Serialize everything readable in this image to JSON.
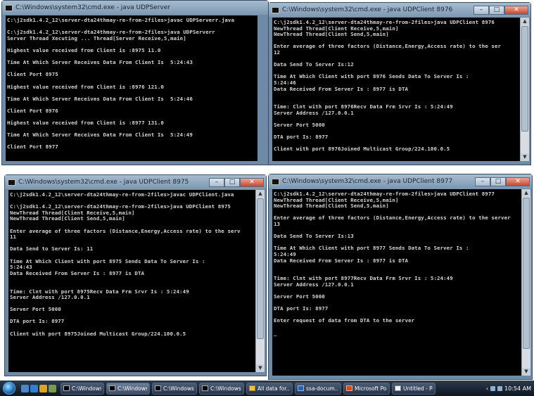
{
  "windows": {
    "server": {
      "title": "C:\\Windows\\system32\\cmd.exe - java  UDPServer",
      "lines": [
        "C:\\j2sdk1.4.2_12\\server-dta24thmay-re-from-2files>javac UDPServerr.java",
        "",
        "C:\\j2sdk1.4.2_12\\server-dta24thmay-re-from-2files>java UDPServerr",
        "Server Thread Xecuting ... Thread[Server Receive,5,main]",
        "",
        "Highest value received from Client is :8975 11.0",
        "",
        "Time At Which Server Receives Data From Client Is  5:24:43",
        "",
        "Client Port 8975",
        "",
        "Highest value received from Client is :8976 121.0",
        "",
        "Time At Which Server Receives Data From Client Is  5:24:46",
        "",
        "Client Port 8976",
        "",
        "Highest value received from Client is :8977 131.0",
        "",
        "Time At Which Server Receives Data From Client Is  5:24:49",
        "",
        "Client Port 8977"
      ]
    },
    "client8976": {
      "title": "C:\\Windows\\system32\\cmd.exe - java  UDPClient 8976",
      "lines": [
        "C:\\j2sdk1.4.2_12\\server-dta24thmay-re-from-2files>java UDPClient 8976",
        "NewThread Thread[Client Receive,5,main]",
        "NewThread Thread[Client Send,5,main]",
        "",
        "Enter average of three factors (Distance,Energy,Access rate) to the ser",
        "12",
        "",
        "Data Send To Server Is:12",
        "",
        "Time At Which Client with port 8976 Sends Data To Server Is :",
        "5:24:46",
        "Data Received From Server Is : 8977 is DTA",
        "",
        "",
        "Time: Clnt with port 8976Recv Data Frm Srvr Is : 5:24:49",
        "Server Address /127.0.0.1",
        "",
        "Server Port 5000",
        "",
        "DTA port Is: 8977",
        "",
        "Client with port 8976Joined Multicast Group/224.100.0.5"
      ]
    },
    "client8975": {
      "title": "C:\\Windows\\system32\\cmd.exe - java  UDPClient 8975",
      "lines": [
        "C:\\j2sdk1.4.2_12\\server-dta24thmay-re-from-2files>javac UDPClient.java",
        "",
        "C:\\j2sdk1.4.2_12\\server-dta24thmay-re-from-2files>java UDPClient 8975",
        "NewThread Thread[Client Receive,5,main]",
        "NewThread Thread[Client Send,5,main]",
        "",
        "Enter average of three factors (Distance,Energy,Access rate) to the serv",
        "11",
        "",
        "Data Send to Server Is: 11",
        "",
        "Time At Which Client with port 8975 Sends Data To Server Is :",
        "5:24:43",
        "Data Received From Server Is : 8977 is DTA",
        "",
        "",
        "Time: Clnt with port 8975Recv Data Frm Srvr Is : 5:24:49",
        "Server Address /127.0.0.1",
        "",
        "Server Port 5000",
        "",
        "DTA port Is: 8977",
        "",
        "Client with port 8975Joined Multicast Group/224.100.0.5"
      ]
    },
    "client8977": {
      "title": "C:\\Windows\\system32\\cmd.exe - java  UDPClient 8977",
      "lines": [
        "C:\\j2sdk1.4.2_12\\server-dta24thmay-re-from-2files>java UDPClient 8977",
        "NewThread Thread[Client Receive,5,main]",
        "NewThread Thread[Client Send,5,main]",
        "",
        "Enter average of three factors (Distance,Energy,Access rate) to the server",
        "13",
        "",
        "Data Send To Server Is:13",
        "",
        "Time At Which Client with port 8977 Sends Data To Server Is :",
        "5:24:49",
        "Data Received From Server Is : 8977 is DTA",
        "",
        "",
        "Time: Clnt with port 8977Recv Data Frm Srvr Is : 5:24:49",
        "Server Address /127.0.0.1",
        "",
        "Server Port 5000",
        "",
        "DTA port Is: 8977",
        "",
        "Enter request of data from DTA to the server",
        "",
        "_"
      ]
    }
  },
  "window_controls": {
    "minimize": "–",
    "maximize": "□",
    "close": "✕"
  },
  "taskbar": {
    "tasks": [
      {
        "label": "C:\\Windows...",
        "icon": "cmd-icon"
      },
      {
        "label": "C:\\Windows...",
        "icon": "cmd-icon"
      },
      {
        "label": "C:\\Windows...",
        "icon": "cmd-icon"
      },
      {
        "label": "C:\\Windows...",
        "icon": "cmd-icon"
      },
      {
        "label": "All data for...",
        "icon": "folder-icon"
      },
      {
        "label": "ssa-docum...",
        "icon": "word-icon"
      },
      {
        "label": "Microsoft Po...",
        "icon": "powerpoint-icon"
      },
      {
        "label": "Untitled - Pai...",
        "icon": "paint-icon"
      }
    ],
    "clock": "10:54 AM"
  }
}
